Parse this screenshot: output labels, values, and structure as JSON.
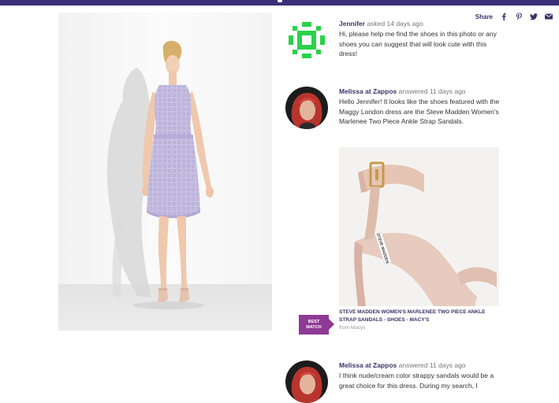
{
  "share": {
    "label": "Share"
  },
  "posts": [
    {
      "name": "Jennifer",
      "org": "",
      "action": "asked 14 days ago",
      "body": "Hi, please help me find the shoes in this photo or any shoes you can suggest that will look cute with this dress!"
    },
    {
      "name": "Melissa",
      "org": "at Zappos",
      "action": "answered 11 days ago",
      "body": "Hello Jennifer! It looks like the shoes featured with the Maggy London dress are the Steve Madden Women's Marlenee Two Piece Ankle Strap Sandals."
    },
    {
      "name": "Melissa",
      "org": "at Zappos",
      "action": "answered 11 days ago",
      "body": "I think nude/cream color strappy sandals would be a great choice for this dress. During my search, I"
    }
  ],
  "product": {
    "badge_line1": "BEST",
    "badge_line2": "MATCH",
    "title": "STEVE MADDEN WOMEN'S MARLENEE TWO PIECE ANKLE STRAP SANDALS - SHOES - MACY'S",
    "source": "from Macys",
    "strap_brand": "STEVE MADDEN"
  },
  "icons": [
    "facebook-icon",
    "pinterest-icon",
    "twitter-icon",
    "email-icon"
  ],
  "colors": {
    "brand": "#3b2f7a",
    "badge": "#8f3a96",
    "jennifer_avatar": "#2bd14a"
  }
}
